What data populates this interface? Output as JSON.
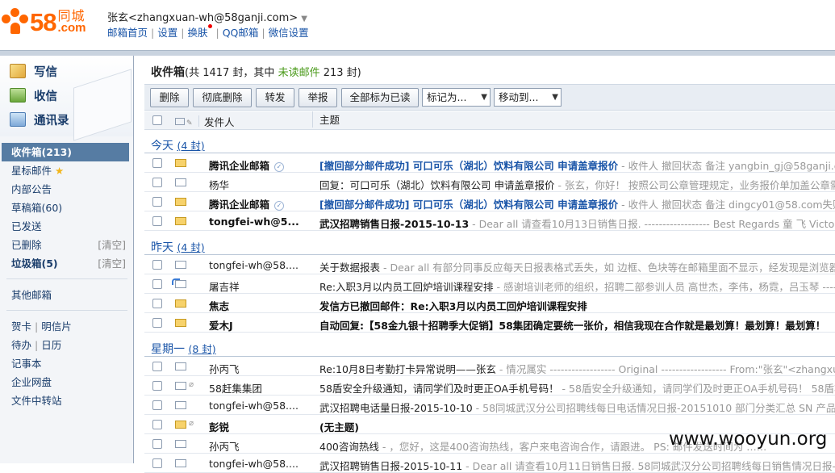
{
  "brand": {
    "num": "58",
    "cn_top": "同城",
    "cn_bottom": ".com",
    "color": "#ff6600"
  },
  "account": {
    "name": "张玄",
    "email": "<zhangxuan-wh@58ganji.com>",
    "arrow": "▼"
  },
  "top_links": [
    "邮箱首页",
    "设置",
    "换肤",
    "QQ邮箱",
    "微信设置"
  ],
  "actions": [
    {
      "label": "写信",
      "icon": "compose-icon"
    },
    {
      "label": "收信",
      "icon": "receive-icon"
    },
    {
      "label": "通讯录",
      "icon": "contacts-icon"
    }
  ],
  "folders": {
    "inbox": "收件箱(213)",
    "starred": "星标邮件",
    "announce": "内部公告",
    "drafts": "草稿箱(60)",
    "sent": "已发送",
    "deleted": "已删除",
    "junk": "垃圾箱(5)",
    "clear": "[清空]",
    "other": "其他邮箱",
    "card": "贺卡",
    "postcard": "明信片",
    "todo": "待办",
    "calendar": "日历",
    "notes": "记事本",
    "disk": "企业网盘",
    "transfer": "文件中转站"
  },
  "inbox_title": {
    "name": "收件箱",
    "pre": "(共 1417 封，其中 ",
    "unread": "未读邮件",
    "post": " 213 封)"
  },
  "toolbar": {
    "delete": "删除",
    "perm_delete": "彻底删除",
    "forward": "转发",
    "report": "举报",
    "mark_all_read": "全部标为已读",
    "mark_as": "标记为...",
    "move_to": "移动到..."
  },
  "columns": {
    "from": "发件人",
    "subject": "主题"
  },
  "groups": [
    {
      "label": "今天",
      "count": "(4 封)"
    },
    {
      "label": "昨天",
      "count": "(4 封)"
    },
    {
      "label": "星期一",
      "count": "(8 封)"
    }
  ],
  "rows": [
    {
      "from": "腾讯企业邮箱",
      "subject": "[撤回部分邮件成功] 可口可乐（湖北）饮料有限公司  申请盖章报价",
      "preview": " - 收件人 撤回状态 备注 yangbin_gj@58ganji.com"
    },
    {
      "from": "杨华",
      "subject": "回复：可口可乐（湖北）饮料有限公司  申请盖章报价",
      "preview": " - 张玄，你好！ 按照公司公章管理规定，业务报价单加盖公章需要去"
    },
    {
      "from": "腾讯企业邮箱",
      "subject": "[撤回部分邮件成功] 可口可乐（湖北）饮料有限公司  申请盖章报价",
      "preview": " - 收件人 撤回状态 备注 dingcy01@58.com失败"
    },
    {
      "from": "tongfei-wh@5...",
      "subject": "武汉招聘销售日报-2015-10-13",
      "preview": " - Dear all 请查看10月13日销售日报. ------------------ Best Regards 童 飞 Victor"
    },
    {
      "from": "tongfei-wh@58....",
      "subject": "关于数据报表",
      "preview": " - Dear all 有部分同事反应每天日报表格式丢失，如 边框、色块等在邮箱里面不显示，经发现是浏览器问题"
    },
    {
      "from": "屠吉祥",
      "subject": "Re:入职3月以内员工回炉培训课程安排",
      "preview": " - 感谢培训老师的组织，招聘二部参训人员 高世杰，李伟，杨霓，吕玉琴 ----------"
    },
    {
      "from": "焦志",
      "subject": "发信方已撤回邮件：Re:入职3月以内员工回炉培训课程安排",
      "preview": ""
    },
    {
      "from": "爱木J",
      "subject": "自动回复:【58金九银十招聘季大促销】58集团确定要统一张价，相信我现在合作就是最划算！最划算！最划算！",
      "preview": ""
    },
    {
      "from": "孙丙飞",
      "subject": "Re:10月8日考勤打卡异常说明——张玄",
      "preview": " - 情况属实 ------------------ Original ------------------ From:\"张玄\"<zhangxuan"
    },
    {
      "from": "58赶集集团",
      "subject": "58盾安全升级通知，请同学们及时更正OA手机号码！",
      "preview": " - 58盾安全升级通知，请同学们及时更正OA手机号码！ 58盾将于1"
    },
    {
      "from": "tongfei-wh@58....",
      "subject": "武汉招聘电话量日报-2015-10-10",
      "preview": " - 58同城武汉分公司招聘线每日电话情况日报-20151010 部门分类汇总 SN 产品线 团"
    },
    {
      "from": "彭锐",
      "subject": "(无主题)",
      "preview": ""
    },
    {
      "from": "孙丙飞",
      "subject": "400咨询热线",
      "preview": " - ，您好，这是400咨询热线，客户来电咨询合作，请跟进。 PS: 邮件发送时间为 ……"
    },
    {
      "from": "tongfei-wh@58....",
      "subject": "武汉招聘销售日报-2015-10-11",
      "preview": " - Dear all 请查看10月11日销售日报. 58同城武汉分公司招聘线每日销售情况日报-2015"
    }
  ],
  "watermark": "www.wooyun.org"
}
